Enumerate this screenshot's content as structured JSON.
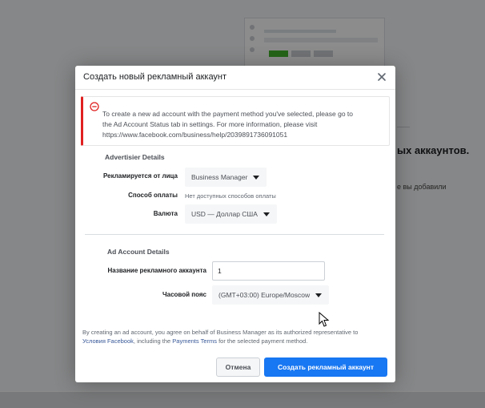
{
  "background": {
    "heading": "ых аккаунтов.",
    "subtext": "е вы добавили"
  },
  "dialog": {
    "title": "Создать новый рекламный аккаунт",
    "alert": {
      "line1": "To create a new ad account with the payment method you've selected, please go to",
      "line2": "the Ad Account Status tab in settings. For more information, please visit",
      "line3": "https://www.facebook.com/business/help/2039891736091051"
    },
    "advertiser_section": {
      "title": "Advertisier Details",
      "advertised_as_label": "Рекламируется от лица",
      "advertised_as_value": "Business Manager",
      "payment_label": "Способ оплаты",
      "payment_value": "Нет доступных способов оплаты",
      "currency_label": "Валюта",
      "currency_value": "USD — Доллар США"
    },
    "account_section": {
      "title": "Ad Account Details",
      "name_label": "Название рекламного аккаунта",
      "name_value": "1",
      "timezone_label": "Часовой пояс",
      "timezone_value": "(GMT+03:00) Europe/Moscow"
    },
    "disclaimer": {
      "part1": "By creating an ad account, you agree on behalf of Business Manager as its authorized representative to",
      "link1": "Условия Facebook",
      "part2": ", including the ",
      "link2": "Payments Terms",
      "part3": " for the selected payment method."
    },
    "buttons": {
      "cancel": "Отмена",
      "create": "Создать рекламный аккаунт"
    }
  },
  "colors": {
    "primary": "#1877f2",
    "alert_border": "#e02020",
    "link": "#385898"
  }
}
